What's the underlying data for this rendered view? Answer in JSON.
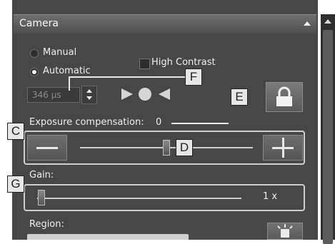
{
  "panel": {
    "title": "Camera",
    "collapse_icon": "triangle-up-icon"
  },
  "mode": {
    "manual_label": "Manual",
    "automatic_label": "Automatic",
    "selected": "Automatic"
  },
  "high_contrast": {
    "label": "High Contrast",
    "checked": false
  },
  "exposure": {
    "value": "346 µs",
    "auto_exposure_icon": "auto-exposure-icon",
    "lock_icon": "lock-icon"
  },
  "exposure_compensation": {
    "label": "Exposure compensation:",
    "value": "0",
    "decrease_icon": "minus-icon",
    "increase_icon": "plus-icon",
    "slider_level": 0.5
  },
  "gain": {
    "label": "Gain:",
    "value": "1 x",
    "slider_level": 0.0
  },
  "region": {
    "label": "Region:",
    "icon": "region-select-icon"
  },
  "callouts": {
    "c": "C",
    "d": "D",
    "e": "E",
    "f": "F",
    "g": "G"
  },
  "colors": {
    "panel_bg": "#474747",
    "title_bar": "#5e5e5e",
    "text": "#ececec",
    "callout_bg": "#e6e6e6"
  }
}
